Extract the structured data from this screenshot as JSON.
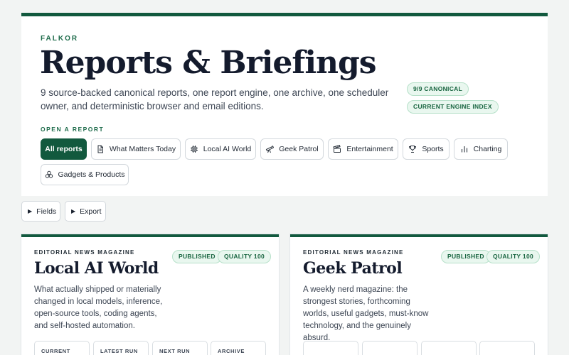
{
  "hero": {
    "brand": "FALKOR",
    "title": "Reports & Briefings",
    "description": "9 source-backed canonical reports, one report engine, one archive, one scheduler owner, and deterministic browser and email editions.",
    "badges": [
      "9/9 CANONICAL",
      "CURRENT ENGINE INDEX"
    ],
    "open_label": "OPEN A REPORT",
    "buttons": {
      "all": {
        "label": "All reports",
        "active": true
      },
      "what_matters": {
        "label": "What Matters Today",
        "icon": "document-icon"
      },
      "local_ai": {
        "label": "Local AI World",
        "icon": "chip-icon"
      },
      "geek_patrol": {
        "label": "Geek Patrol",
        "icon": "telescope-icon"
      },
      "entertainment": {
        "label": "Entertainment",
        "icon": "clapperboard-icon"
      },
      "sports": {
        "label": "Sports",
        "icon": "trophy-icon"
      },
      "charting": {
        "label": "Charting",
        "icon": "bar-chart-icon"
      },
      "gadgets": {
        "label": "Gadgets & Products",
        "icon": "cubes-icon"
      }
    }
  },
  "toolbar": {
    "fields": "Fields",
    "export": "Export"
  },
  "cards": [
    {
      "kicker": "EDITORIAL NEWS MAGAZINE",
      "title": "Local AI World",
      "description": "What actually shipped or materially changed in local models, inference, open-source tools, coding agents, and self-hosted automation.",
      "badges": [
        "PUBLISHED",
        "QUALITY 100"
      ],
      "stats": [
        "CURRENT",
        "LATEST RUN",
        "NEXT RUN",
        "ARCHIVE"
      ]
    },
    {
      "kicker": "EDITORIAL NEWS MAGAZINE",
      "title": "Geek Patrol",
      "description": "A weekly nerd magazine: the strongest stories, forthcoming worlds, useful gadgets, must-know technology, and the genuinely absurd.",
      "badges": [
        "PUBLISHED",
        "QUALITY 100"
      ],
      "stats": [
        "",
        "",
        "",
        ""
      ]
    }
  ],
  "colors": {
    "accent": "#12593e",
    "badge_bg": "#e9f7ef",
    "badge_text": "#17643f",
    "background": "#f2f4f3"
  }
}
